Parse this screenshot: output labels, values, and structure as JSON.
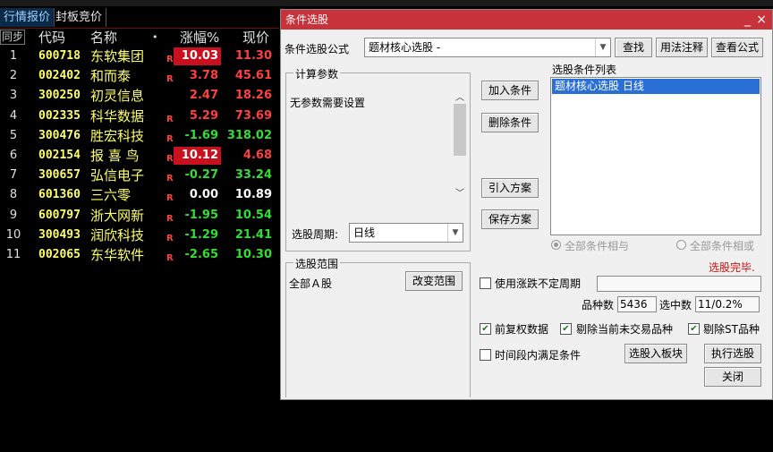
{
  "tabs": [
    "行情报价",
    "封板竞价"
  ],
  "header": {
    "sync": "同步",
    "code": "代码",
    "name": "名称",
    "dot": "•",
    "chg": "涨幅%",
    "price": "现价"
  },
  "stocks": [
    {
      "idx": "1",
      "code": "600718",
      "name": "东软集团",
      "r": "R",
      "chg": "10.03",
      "price": "11.30",
      "dir": "up",
      "hl": true
    },
    {
      "idx": "2",
      "code": "002402",
      "name": "和而泰",
      "r": "R",
      "chg": "3.78",
      "price": "45.61",
      "dir": "up",
      "hl": false
    },
    {
      "idx": "3",
      "code": "300250",
      "name": "初灵信息",
      "r": "",
      "chg": "2.47",
      "price": "18.26",
      "dir": "up",
      "hl": false
    },
    {
      "idx": "4",
      "code": "002335",
      "name": "科华数据",
      "r": "R",
      "chg": "5.29",
      "price": "73.69",
      "dir": "up",
      "hl": false
    },
    {
      "idx": "5",
      "code": "300476",
      "name": "胜宏科技",
      "r": "R",
      "chg": "-1.69",
      "price": "318.02",
      "dir": "down",
      "hl": false
    },
    {
      "idx": "6",
      "code": "002154",
      "name": "报 喜 鸟",
      "r": "R",
      "chg": "10.12",
      "price": "4.68",
      "dir": "up",
      "hl": true
    },
    {
      "idx": "7",
      "code": "300657",
      "name": "弘信电子",
      "r": "R",
      "chg": "-0.27",
      "price": "33.24",
      "dir": "down",
      "hl": false
    },
    {
      "idx": "8",
      "code": "601360",
      "name": "三六零",
      "r": "R",
      "chg": "0.00",
      "price": "10.89",
      "dir": "flat",
      "hl": false
    },
    {
      "idx": "9",
      "code": "600797",
      "name": "浙大网新",
      "r": "R",
      "chg": "-1.95",
      "price": "10.54",
      "dir": "down",
      "hl": false
    },
    {
      "idx": "10",
      "code": "300493",
      "name": "润欣科技",
      "r": "R",
      "chg": "-1.29",
      "price": "21.41",
      "dir": "down",
      "hl": false
    },
    {
      "idx": "11",
      "code": "002065",
      "name": "东华软件",
      "r": "R",
      "chg": "-2.65",
      "price": "10.30",
      "dir": "down",
      "hl": false
    }
  ],
  "dialog": {
    "title": "条件选股",
    "close_label": "×",
    "formula_label": "条件选股公式",
    "formula_value": "题材核心选股  -",
    "find": "查找",
    "usage": "用法注释",
    "view": "查看公式",
    "params_group": "计算参数",
    "params_text": "无参数需要设置",
    "add": "加入条件",
    "delete": "删除条件",
    "import": "引入方案",
    "save": "保存方案",
    "list_label": "选股条件列表",
    "list_item": "题材核心选股  日线",
    "period_label": "选股周期:",
    "period_value": "日线",
    "radio_and": "全部条件相与",
    "radio_or": "全部条件相或",
    "done": "选股完毕.",
    "range_group": "选股范围",
    "range_value": "全部Ａ股",
    "change_range": "改变范围",
    "use_period": "使用涨跌不定周期",
    "count_label": "品种数",
    "count_value": "5436",
    "selected_label": "选中数",
    "selected_value": "11/0.2%",
    "fq": "前复权数据",
    "exclude_untraded": "剔除当前未交易品种",
    "exclude_st": "剔除ST品种",
    "time_range": "时间段内满足条件",
    "to_board": "选股入板块",
    "execute": "执行选股",
    "close": "关闭"
  }
}
